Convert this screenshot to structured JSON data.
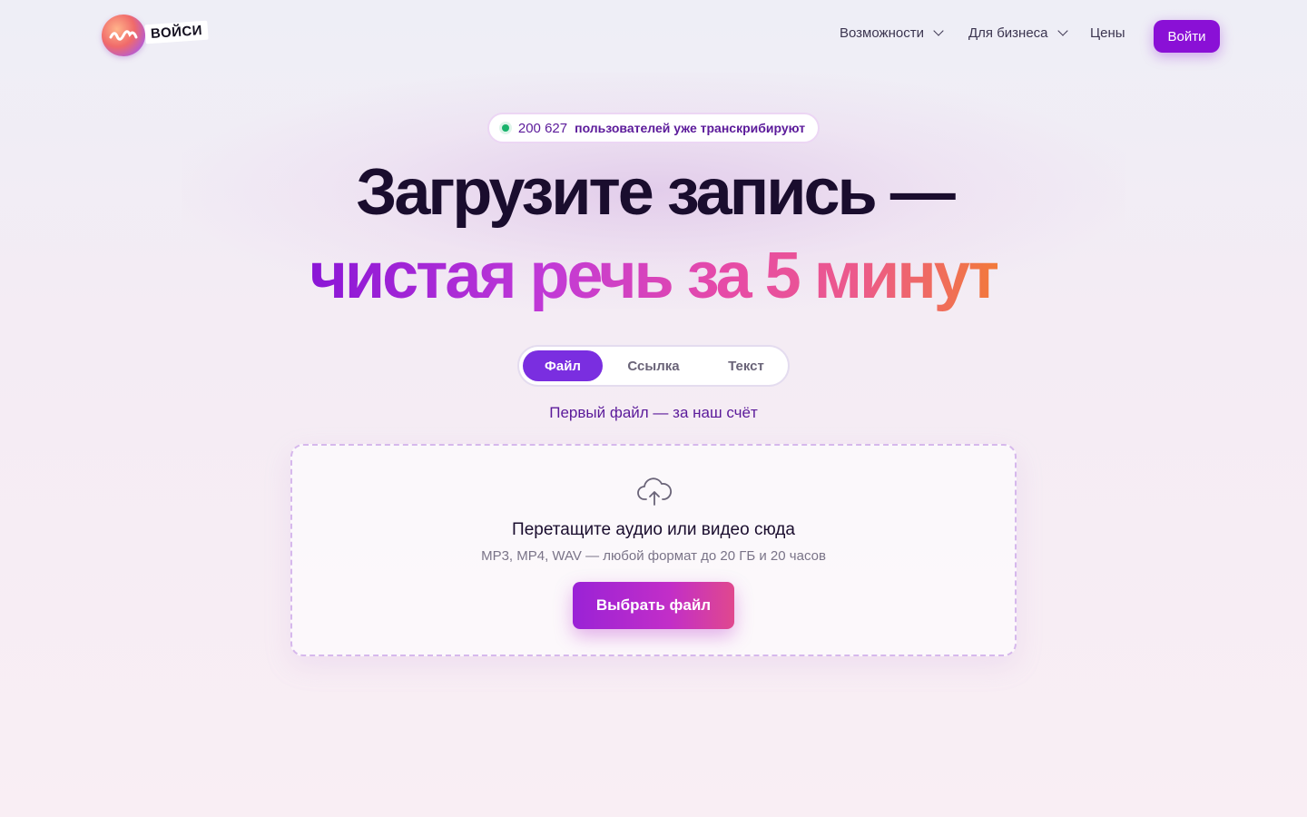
{
  "brand": {
    "name": "ВОЙСИ"
  },
  "nav": {
    "features": "Возможности",
    "business": "Для бизнеса",
    "prices": "Цены",
    "login": "Войти"
  },
  "badge": {
    "count": "200 627",
    "text": "пользователей уже транскрибируют",
    "status_color": "#18b36b"
  },
  "hero": {
    "line1": "Загрузите запись —",
    "line2": "чистая речь за 5 минут"
  },
  "tabs": [
    {
      "label": "Файл",
      "active": true
    },
    {
      "label": "Ссылка",
      "active": false
    },
    {
      "label": "Текст",
      "active": false
    }
  ],
  "free_note": "Первый файл — за наш счёт",
  "dropzone": {
    "icon": "cloud-upload-icon",
    "title": "Перетащите аудио или видео сюда",
    "subtitle": "MP3, MP4, WAV — любой формат до 20 ГБ и 20 часов",
    "button": "Выбрать файл"
  },
  "colors": {
    "accent": "#8a10d6",
    "tab_active": "#7a2ee0",
    "heading": "#1a0d2e"
  }
}
